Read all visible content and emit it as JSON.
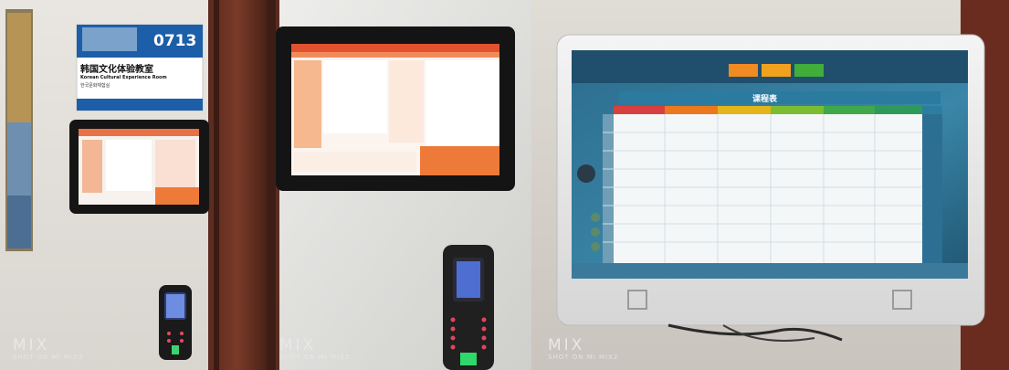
{
  "photo_collage": {
    "panel_count": 3,
    "panel_1": {
      "door_sign": {
        "room_number": "0713",
        "title_cn": "韩国文化体验教室",
        "title_en": "Korean Cultural Experience Room",
        "title_kr": "한국문화체험실"
      },
      "watermark": {
        "brand": "MIX",
        "caption": "SHOT ON MI MIX2"
      }
    },
    "panel_2": {
      "watermark": {
        "brand": "MIX",
        "caption": "SHOT ON MI MIX2"
      }
    },
    "panel_3": {
      "timetable_screen": {
        "header_buttons": [
          {
            "label": "",
            "color": "#f08a22"
          },
          {
            "label": "",
            "color": "#f0a21e"
          },
          {
            "label": "",
            "color": "#3fae3a"
          }
        ],
        "table_title": "课程表",
        "column_colors": [
          "#d64040",
          "#e9781e",
          "#e2b51b",
          "#7bbd31",
          "#3fa84a",
          "#2e9a5a",
          "#2b7ea0"
        ],
        "rows": 8
      },
      "watermark": {
        "brand": "MIX",
        "caption": "SHOT ON MI MIX2"
      }
    }
  }
}
